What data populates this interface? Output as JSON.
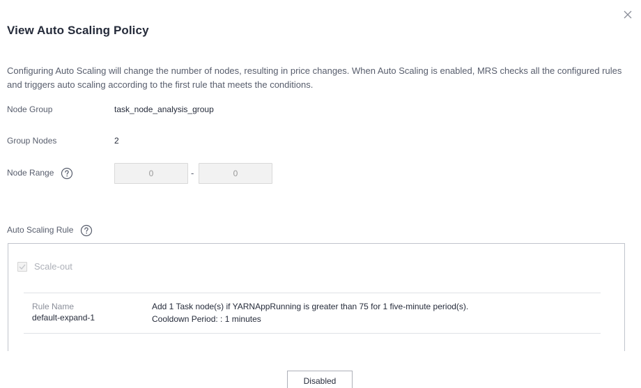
{
  "dialog": {
    "title": "View Auto Scaling Policy",
    "close_icon": "close-icon",
    "description": "Configuring Auto Scaling will change the number of nodes, resulting in price changes. When Auto Scaling is enabled, MRS checks all the configured rules and triggers auto scaling according to the first rule that meets the conditions."
  },
  "fields": {
    "node_group_label": "Node Group",
    "node_group_value": "task_node_analysis_group",
    "group_nodes_label": "Group Nodes",
    "group_nodes_value": "2",
    "node_range_label": "Node Range",
    "node_range_min": "0",
    "node_range_max": "0",
    "range_separator": "-",
    "help_icon": "question-circle-icon"
  },
  "rules": {
    "section_label": "Auto Scaling Rule",
    "scale_out_label": "Scale-out",
    "scale_out_checked": true,
    "rule_name_label": "Rule Name",
    "rule_name_value": "default-expand-1",
    "rule_description": "Add 1 Task node(s) if YARNAppRunning is greater than 75 for 1 five-minute period(s).",
    "cooldown_text": "Cooldown Period: :   1 minutes"
  },
  "footer": {
    "button_label": "Disabled"
  },
  "colors": {
    "title": "#252b3a",
    "muted_text": "#575d6c",
    "disabled_text": "#adb0b8",
    "border": "#c0c4cc"
  }
}
